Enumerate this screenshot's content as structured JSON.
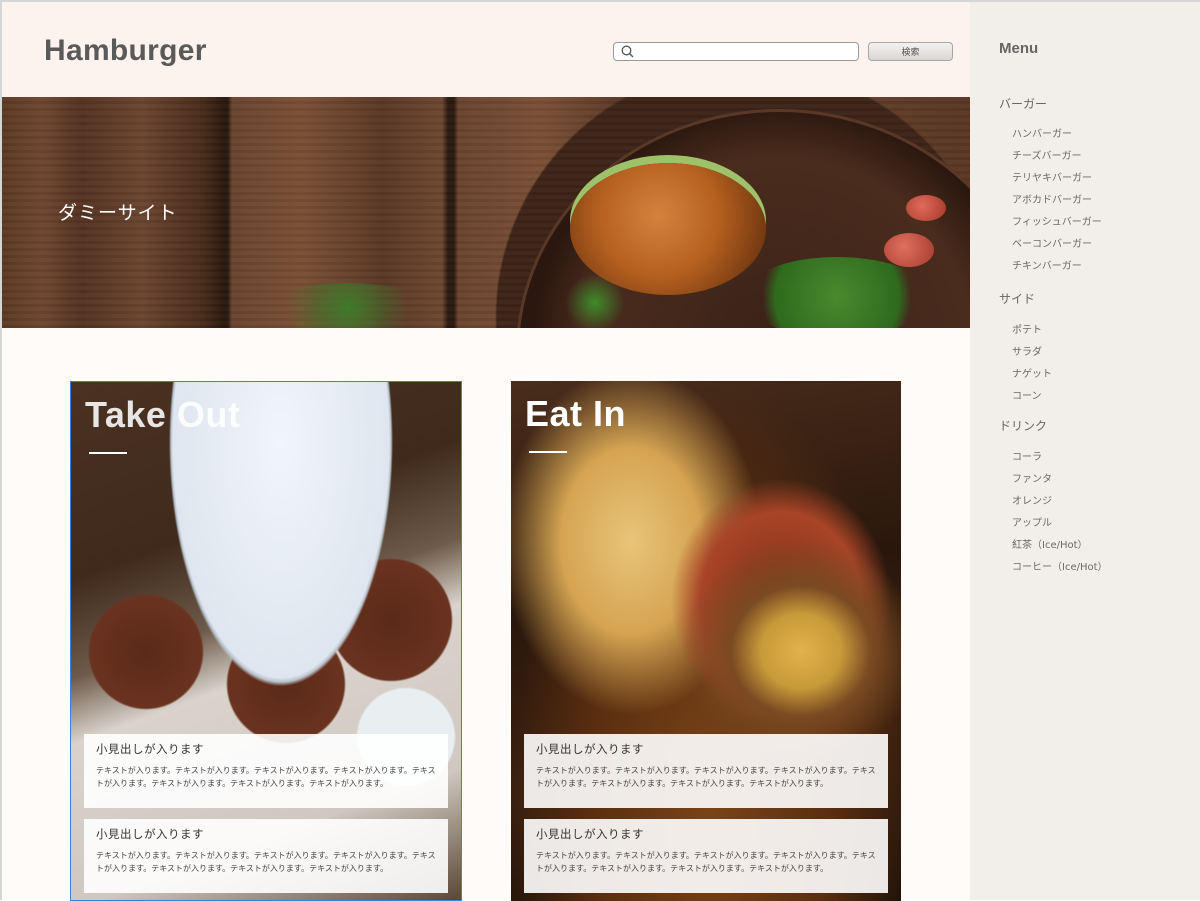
{
  "header": {
    "logo": "Hamburger",
    "search_placeholder": "",
    "search_button": "検索"
  },
  "hero": {
    "text": "ダミーサイト"
  },
  "cards": [
    {
      "title": "Take Out",
      "boxes": [
        {
          "heading": "小見出しが入ります",
          "text": "テキストが入ります。テキストが入ります。テキストが入ります。テキストが入ります。テキストが入ります。テキストが入ります。テキストが入ります。テキストが入ります。"
        },
        {
          "heading": "小見出しが入ります",
          "text": "テキストが入ります。テキストが入ります。テキストが入ります。テキストが入ります。テキストが入ります。テキストが入ります。テキストが入ります。テキストが入ります。"
        }
      ]
    },
    {
      "title": "Eat In",
      "boxes": [
        {
          "heading": "小見出しが入ります",
          "text": "テキストが入ります。テキストが入ります。テキストが入ります。テキストが入ります。テキストが入ります。テキストが入ります。テキストが入ります。テキストが入ります。"
        },
        {
          "heading": "小見出しが入ります",
          "text": "テキストが入ります。テキストが入ります。テキストが入ります。テキストが入ります。テキストが入ります。テキストが入ります。テキストが入ります。テキストが入ります。"
        }
      ]
    }
  ],
  "sidebar": {
    "title": "Menu",
    "categories": [
      {
        "label": "バーガー",
        "items": [
          "ハンバーガー",
          "チーズバーガー",
          "テリヤキバーガー",
          "アボカドバーガー",
          "フィッシュバーガー",
          "ベーコンバーガー",
          "チキンバーガー"
        ]
      },
      {
        "label": "サイド",
        "items": [
          "ポテト",
          "サラダ",
          "ナゲット",
          "コーン"
        ]
      },
      {
        "label": "ドリンク",
        "items": [
          "コーラ",
          "ファンタ",
          "オレンジ",
          "アップル",
          "紅茶（Ice/Hot）",
          "コーヒー（Ice/Hot）"
        ]
      }
    ]
  },
  "colors": {
    "header_bg": "#fdf3ee",
    "sidebar_bg": "#f2eeea",
    "main_bg": "#fffbf8",
    "selection_outline": "#3c7fe0"
  }
}
